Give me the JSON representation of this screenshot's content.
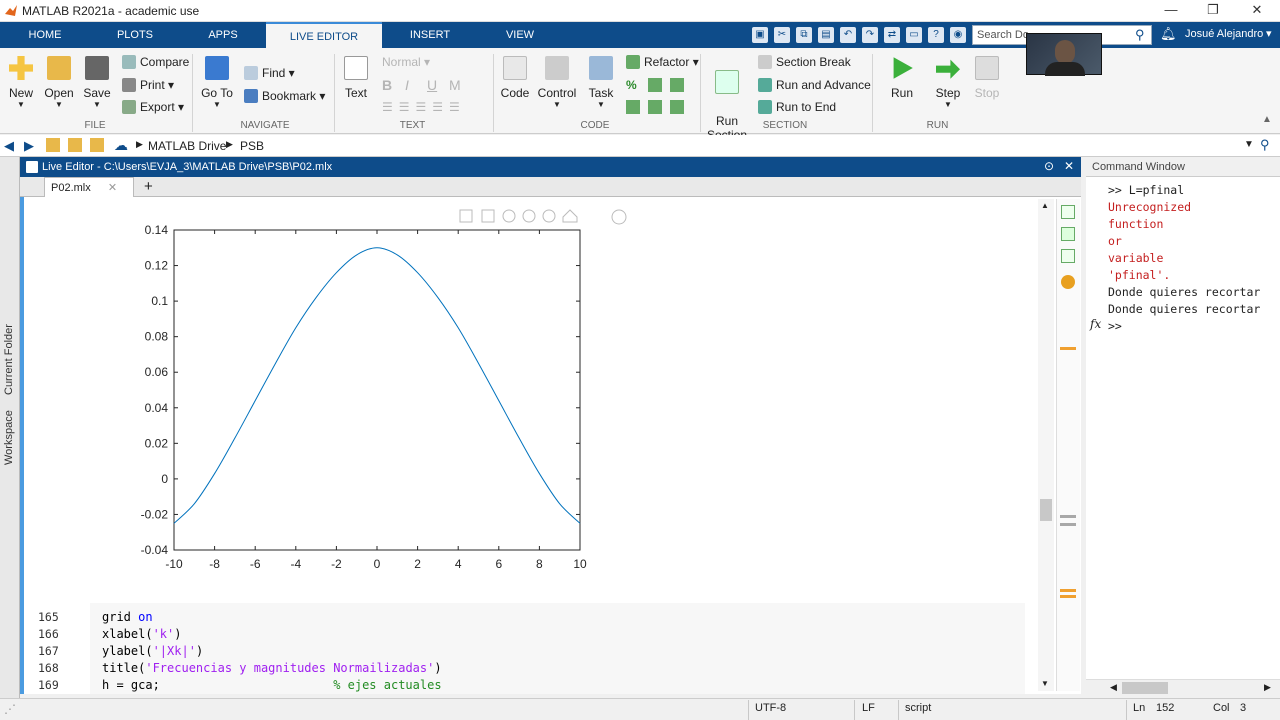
{
  "window": {
    "title": "MATLAB R2021a - academic use"
  },
  "tabs": [
    "HOME",
    "PLOTS",
    "APPS",
    "LIVE EDITOR",
    "INSERT",
    "VIEW"
  ],
  "active_tab": "LIVE EDITOR",
  "search": {
    "placeholder": "Search Do"
  },
  "user": {
    "name": "Josué Alejandro"
  },
  "ribbon": {
    "file": {
      "label": "FILE",
      "new": "New",
      "open": "Open",
      "save": "Save",
      "compare": "Compare",
      "print": "Print",
      "export": "Export"
    },
    "navigate": {
      "label": "NAVIGATE",
      "goto": "Go To",
      "find": "Find",
      "bookmark": "Bookmark"
    },
    "text": {
      "label": "TEXT",
      "text": "Text",
      "style": "Normal",
      "bold": "B",
      "italic": "I",
      "underline": "U",
      "mono": "M"
    },
    "code": {
      "label": "CODE",
      "code": "Code",
      "control": "Control",
      "task": "Task",
      "refactor": "Refactor",
      "percent": "%"
    },
    "section": {
      "label": "SECTION",
      "run_section": "Run\nSection",
      "section_break": "Section Break",
      "run_advance": "Run and Advance",
      "run_end": "Run to End"
    },
    "run": {
      "label": "RUN",
      "run": "Run",
      "step": "Step",
      "stop": "Stop"
    }
  },
  "address": {
    "crumbs": [
      "MATLAB Drive",
      "PSB"
    ]
  },
  "leftstrip": {
    "current_folder": "Current Folder",
    "workspace": "Workspace"
  },
  "editor": {
    "header": "Live Editor - C:\\Users\\EVJA_3\\MATLAB Drive\\PSB\\P02.mlx",
    "file_tab": "P02.mlx",
    "lines": [
      {
        "n": "165",
        "parts": [
          [
            "grid ",
            ""
          ],
          [
            "on",
            "kw"
          ]
        ]
      },
      {
        "n": "166",
        "parts": [
          [
            "xlabel(",
            ""
          ],
          [
            "'k'",
            "str"
          ],
          [
            ")",
            ""
          ]
        ]
      },
      {
        "n": "167",
        "parts": [
          [
            "ylabel(",
            ""
          ],
          [
            "'|Xk|'",
            "str"
          ],
          [
            ")",
            ""
          ]
        ]
      },
      {
        "n": "168",
        "parts": [
          [
            "title(",
            ""
          ],
          [
            "'Frecuencias y magnitudes Normailizadas'",
            "str"
          ],
          [
            ")",
            ""
          ]
        ]
      },
      {
        "n": "169",
        "parts": [
          [
            "h = gca;                        ",
            ""
          ],
          [
            "% ejes actuales",
            "cm"
          ]
        ]
      }
    ]
  },
  "chart_data": {
    "type": "line",
    "x_function": "0.13*sin(x)/x-ish bell (sampled)",
    "x": [
      -10,
      -9,
      -8,
      -7,
      -6,
      -5,
      -4,
      -3,
      -2,
      -1,
      0,
      1,
      2,
      3,
      4,
      5,
      6,
      7,
      8,
      9,
      10
    ],
    "y": [
      -0.025,
      -0.014,
      0.003,
      0.023,
      0.044,
      0.065,
      0.085,
      0.102,
      0.116,
      0.126,
      0.13,
      0.126,
      0.116,
      0.102,
      0.085,
      0.065,
      0.044,
      0.023,
      0.003,
      -0.014,
      -0.025
    ],
    "xlim": [
      -10,
      10
    ],
    "ylim": [
      -0.04,
      0.14
    ],
    "xticks": [
      -10,
      -8,
      -6,
      -4,
      -2,
      0,
      2,
      4,
      6,
      8,
      10
    ],
    "yticks": [
      -0.04,
      -0.02,
      0,
      0.02,
      0.04,
      0.06,
      0.08,
      0.1,
      0.12,
      0.14
    ],
    "ytick_labels": [
      "-0.04",
      "-0.02",
      "0",
      "0.02",
      "0.04",
      "0.06",
      "0.08",
      "0.1",
      "0.12",
      "0.14"
    ],
    "color": "#0072bd",
    "grid": false
  },
  "command_window": {
    "title": "Command Window",
    "lines": [
      {
        "t": ">> L=pfinal",
        "c": ""
      },
      {
        "t": "Unrecognized",
        "c": "err"
      },
      {
        "t": "function",
        "c": "err"
      },
      {
        "t": "or",
        "c": "err"
      },
      {
        "t": "variable",
        "c": "err"
      },
      {
        "t": "'pfinal'.",
        "c": "err"
      },
      {
        "t": "Donde quieres recortar",
        "c": ""
      },
      {
        "t": "Donde quieres recortar",
        "c": ""
      },
      {
        "t": ">>",
        "c": ""
      }
    ],
    "fx": "fx"
  },
  "status": {
    "encoding": "UTF-8",
    "eol": "LF",
    "type": "script",
    "ln_label": "Ln",
    "ln": "152",
    "col_label": "Col",
    "col": "3"
  },
  "colors": {
    "accent": "#0e4c8a",
    "line": "#0072bd"
  }
}
